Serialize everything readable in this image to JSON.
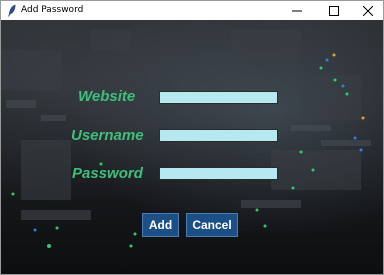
{
  "window": {
    "title": "Add Password",
    "controls": {
      "minimize_icon": "minimize-icon",
      "maximize_icon": "maximize-icon",
      "close_icon": "close-icon"
    }
  },
  "form": {
    "website_label": "Website",
    "username_label": "Username",
    "password_label": "Password",
    "website_value": "",
    "username_value": "",
    "password_value": ""
  },
  "buttons": {
    "add_label": "Add",
    "cancel_label": "Cancel"
  },
  "colors": {
    "label_text": "#3fbf7a",
    "field_background": "#b6e8f0",
    "button_background": "#1c4f86",
    "background_dark": "#1c1e21"
  }
}
